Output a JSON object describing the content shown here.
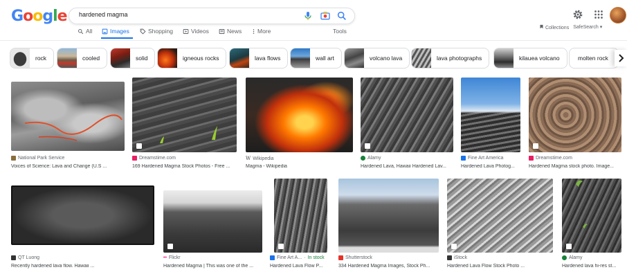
{
  "header": {
    "logo_text": "Google",
    "search_query": "hardened magma",
    "icons": [
      "mic-icon",
      "camera-search-icon",
      "search-icon",
      "settings-gear-icon",
      "apps-grid-icon",
      "account-avatar"
    ],
    "accent_color": "#1a73e8"
  },
  "tabs": [
    {
      "label": "All",
      "icon": "search-icon"
    },
    {
      "label": "Images",
      "icon": "image-icon",
      "active": true
    },
    {
      "label": "Shopping",
      "icon": "tag-icon"
    },
    {
      "label": "Videos",
      "icon": "video-icon"
    },
    {
      "label": "News",
      "icon": "news-icon"
    },
    {
      "label": "More",
      "icon": "more-vert-icon"
    }
  ],
  "tools_label": "Tools",
  "collections_label": "Collections",
  "safesearch_label": "SafeSearch",
  "chips": [
    {
      "label": "rock"
    },
    {
      "label": "cooled"
    },
    {
      "label": "solid"
    },
    {
      "label": "igneous rocks"
    },
    {
      "label": "lava flows"
    },
    {
      "label": "wall art"
    },
    {
      "label": "volcano lava"
    },
    {
      "label": "lava photographs"
    },
    {
      "label": "kilauea volcano"
    },
    {
      "label": "molten rock"
    }
  ],
  "results": [
    {
      "source": "National Park Service",
      "title": "Voices of Science: Lava and Change (U.S ...",
      "fav_color": "#8a6d3b"
    },
    {
      "source": "Dreamstime.com",
      "title": "169 Hardened Magma Stock Photos - Free ...",
      "fav_color": "#e91e63"
    },
    {
      "source": "Wikipedia",
      "title": "Magma - Wikipedia",
      "fav_color": "#444444"
    },
    {
      "source": "Alamy",
      "title": "Hardened Lava, Hawaii Hardened Lav...",
      "fav_color": "#188038"
    },
    {
      "source": "Fine Art America",
      "title": "Hardened Lava Photog...",
      "fav_color": "#1a73e8"
    },
    {
      "source": "Dreamstime.com",
      "title": "Hardened Magma stock photo. Image...",
      "fav_color": "#e91e63"
    },
    {
      "source": "QT Luong",
      "title": "Recently hardened lava flow. Hawaii ...",
      "fav_color": "#333333"
    },
    {
      "source": "Flickr",
      "title": "Hardened Magma | This was one of the ...",
      "fav_color": "#ff0084"
    },
    {
      "source": "Fine Art A...",
      "stock": "In stock",
      "title": "Hardened Lava Flow P...",
      "fav_color": "#1a73e8"
    },
    {
      "source": "Shutterstock",
      "title": "334 Hardened Magma Images, Stock Ph...",
      "fav_color": "#e5332a"
    },
    {
      "source": "iStock",
      "title": "Hardened Lava Flow Stock Photo ...",
      "fav_color": "#333333"
    },
    {
      "source": "Alamy",
      "title": "Hardened lava hi-res st...",
      "fav_color": "#188038"
    }
  ]
}
